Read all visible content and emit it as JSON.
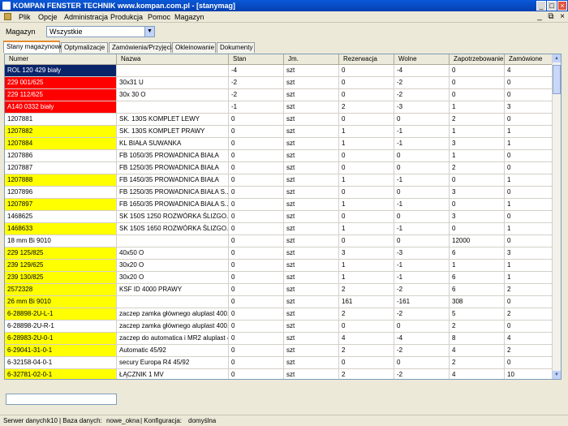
{
  "window": {
    "title": "KOMPAN FENSTER TECHNIK www.kompan.com.pl - [stanymag]",
    "minimize": "_",
    "maximize": "□",
    "close": "×"
  },
  "menu": {
    "items": [
      "Plik",
      "Opcje",
      "Administracja",
      "Produkcja",
      "Pomoc",
      "Magazyn"
    ],
    "child_min": "_",
    "child_restore": "⧉",
    "child_close": "×"
  },
  "filter": {
    "label": "Magazyn",
    "value": "Wszystkie",
    "arrow": "▼"
  },
  "tabs": [
    "Stany magazynowe",
    "Optymalizacje",
    "Zamówienia/Przyjęcia",
    "Okleinowanie",
    "Dokumenty"
  ],
  "columns": [
    "Numer",
    "Nazwa",
    "Stan",
    "Jm.",
    "Rezerwacja",
    "Wolne",
    "Zapotrzebowanie",
    "Zamówione"
  ],
  "colors": {
    "navy": "#0a246a",
    "red": "#ff0000",
    "yellow": "#ffff00",
    "white": "#ffffff"
  },
  "rows": [
    {
      "c": [
        "ROL 120 429 biały",
        "",
        "-4",
        "szt",
        "0",
        "-4",
        "0",
        "4"
      ],
      "color": "navy"
    },
    {
      "c": [
        "229 001/625",
        "30x31 U",
        "-2",
        "szt",
        "0",
        "-2",
        "0",
        "0"
      ],
      "color": "red"
    },
    {
      "c": [
        "229 112/625",
        "30x 30 O",
        "-2",
        "szt",
        "0",
        "-2",
        "0",
        "0"
      ],
      "color": "red"
    },
    {
      "c": [
        "A140 0332 biały",
        "",
        "-1",
        "szt",
        "2",
        "-3",
        "1",
        "3"
      ],
      "color": "red"
    },
    {
      "c": [
        "1207881",
        "SK. 130S KOMPLET LEWY",
        "0",
        "szt",
        "0",
        "0",
        "2",
        "0"
      ],
      "color": "white"
    },
    {
      "c": [
        "1207882",
        "SK. 130S KOMPLET PRAWY",
        "0",
        "szt",
        "1",
        "-1",
        "1",
        "1"
      ],
      "color": "yellow"
    },
    {
      "c": [
        "1207884",
        "KL BIAŁA SUWANKA",
        "0",
        "szt",
        "1",
        "-1",
        "3",
        "1"
      ],
      "color": "yellow"
    },
    {
      "c": [
        "1207886",
        "FB 1050/35 PROWADNICA BIAŁA",
        "0",
        "szt",
        "0",
        "0",
        "1",
        "0"
      ],
      "color": "white"
    },
    {
      "c": [
        "1207887",
        "FB 1250/35 PROWADNICA BIAŁA",
        "0",
        "szt",
        "0",
        "0",
        "2",
        "0"
      ],
      "color": "white"
    },
    {
      "c": [
        "1207888",
        "FB 1450/35 PROWADNICA BIAŁA",
        "0",
        "szt",
        "1",
        "-1",
        "0",
        "1"
      ],
      "color": "yellow"
    },
    {
      "c": [
        "1207896",
        "FB 1250/35 PROWADNICA BIAŁA S...",
        "0",
        "szt",
        "0",
        "0",
        "3",
        "0"
      ],
      "color": "white"
    },
    {
      "c": [
        "1207897",
        "FB 1650/35 PROWADNICA BIAŁA S...",
        "0",
        "szt",
        "1",
        "-1",
        "0",
        "1"
      ],
      "color": "yellow"
    },
    {
      "c": [
        "1468625",
        "SK 150S 1250 ROZWÓRKA ŚLIZGO...",
        "0",
        "szt",
        "0",
        "0",
        "3",
        "0"
      ],
      "color": "white"
    },
    {
      "c": [
        "1468633",
        "SK 150S 1650 ROZWÓRKA ŚLIZGO...",
        "0",
        "szt",
        "1",
        "-1",
        "0",
        "1"
      ],
      "color": "yellow"
    },
    {
      "c": [
        "18 mm Bi 9010",
        "",
        "0",
        "szt",
        "0",
        "0",
        "12000",
        "0"
      ],
      "color": "white"
    },
    {
      "c": [
        "229 125/825",
        "40x50 O",
        "0",
        "szt",
        "3",
        "-3",
        "6",
        "3"
      ],
      "color": "yellow"
    },
    {
      "c": [
        "239 129/625",
        "30x20 O",
        "0",
        "szt",
        "1",
        "-1",
        "1",
        "1"
      ],
      "color": "yellow"
    },
    {
      "c": [
        "239 130/825",
        "30x20 O",
        "0",
        "szt",
        "1",
        "-1",
        "6",
        "1"
      ],
      "color": "yellow"
    },
    {
      "c": [
        "2572328",
        "KSF ID 4000 PRAWY",
        "0",
        "szt",
        "2",
        "-2",
        "6",
        "2"
      ],
      "color": "yellow"
    },
    {
      "c": [
        "26 mm Bi 9010",
        "",
        "0",
        "szt",
        "161",
        "-161",
        "308",
        "0"
      ],
      "color": "yellow"
    },
    {
      "c": [
        "6-28898-2U-L-1",
        "zaczep zamka głównego aluplast 400...",
        "0",
        "szt",
        "2",
        "-2",
        "5",
        "2"
      ],
      "color": "yellow"
    },
    {
      "c": [
        "6-28898-2U-R-1",
        "zaczep zamka głównego aluplast 400...",
        "0",
        "szt",
        "0",
        "0",
        "2",
        "0"
      ],
      "color": "white"
    },
    {
      "c": [
        "6-28983-2U-0-1",
        "zaczep do automatica i MR2 aluplast 4...",
        "0",
        "szt",
        "4",
        "-4",
        "8",
        "4"
      ],
      "color": "yellow"
    },
    {
      "c": [
        "6-29041-31-0-1",
        "Automatic 45/92",
        "0",
        "szt",
        "2",
        "-2",
        "4",
        "2"
      ],
      "color": "yellow"
    },
    {
      "c": [
        "6-32158-04-0-1",
        "secury Europa R4 45/92",
        "0",
        "szt",
        "0",
        "0",
        "2",
        "0"
      ],
      "color": "white"
    },
    {
      "c": [
        "6-32781-02-0-1",
        "ŁĄCZNIK 1 MV",
        "0",
        "szt",
        "2",
        "-2",
        "4",
        "10"
      ],
      "color": "yellow"
    }
  ],
  "scroll": {
    "up": "▲",
    "down": "▼"
  },
  "status": {
    "server_label": "Serwer danych:",
    "server": "k10",
    "db_label": "| Baza danych:",
    "db": "nowe_okna",
    "config_label": "| Konfiguracja:",
    "config": "domyślna"
  }
}
